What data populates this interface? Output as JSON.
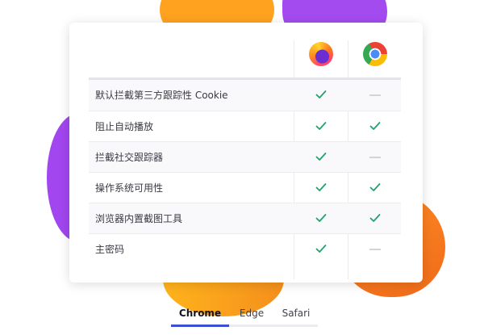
{
  "browsers": [
    {
      "name": "Firefox",
      "icon": "firefox-logo-icon"
    },
    {
      "name": "Chrome",
      "icon": "chrome-logo-icon"
    }
  ],
  "features": [
    {
      "label": "默认拦截第三方跟踪性 Cookie",
      "firefox": "check",
      "chrome": "dash"
    },
    {
      "label": "阻止自动播放",
      "firefox": "check",
      "chrome": "check"
    },
    {
      "label": "拦截社交跟踪器",
      "firefox": "check",
      "chrome": "dash"
    },
    {
      "label": "操作系统可用性",
      "firefox": "check",
      "chrome": "check"
    },
    {
      "label": "浏览器内置截图工具",
      "firefox": "check",
      "chrome": "check"
    },
    {
      "label": "主密码",
      "firefox": "check",
      "chrome": "dash"
    }
  ],
  "tabs": [
    {
      "label": "Chrome",
      "active": true
    },
    {
      "label": "Edge",
      "active": false
    },
    {
      "label": "Safari",
      "active": false
    }
  ],
  "colors": {
    "check": "#21a36b",
    "dash": "#d4d4d8",
    "tab_indicator": "#3d4fd1",
    "accent_orange": "#ffa21f",
    "accent_purple": "#a44bf0"
  }
}
